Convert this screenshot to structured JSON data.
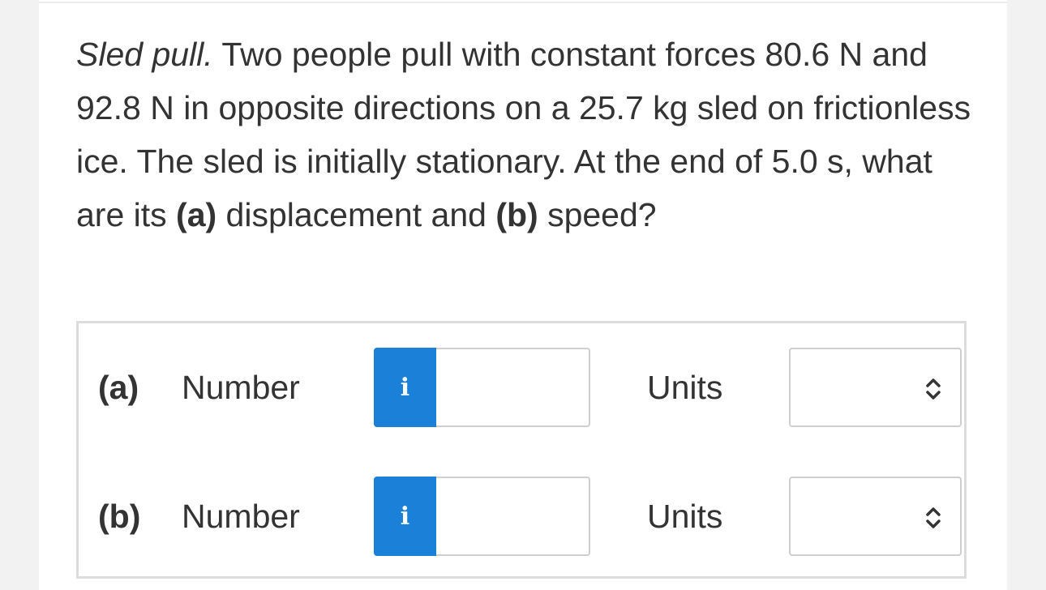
{
  "question": {
    "title": "Sled pull.",
    "text_1": " Two people pull with constant forces 80.6 N and 92.8 N in opposite directions on a 25.7 kg sled on frictionless ice. The sled is initially stationary. At the end of 5.0 s, what are its ",
    "part_a_marker": "(a)",
    "text_2": " displacement and ",
    "part_b_marker": "(b)",
    "text_3": " speed?"
  },
  "answers": [
    {
      "part_label": "(a)",
      "number_label": "Number",
      "info_glyph": "i",
      "number_value": "",
      "units_label": "Units",
      "units_selected": ""
    },
    {
      "part_label": "(b)",
      "number_label": "Number",
      "info_glyph": "i",
      "number_value": "",
      "units_label": "Units",
      "units_selected": ""
    }
  ],
  "colors": {
    "info_button": "#1a80d8",
    "text": "#333333",
    "border": "#dcdcdc"
  },
  "icons": {
    "info": "info-icon",
    "select_arrows": "chevron-up-down-icon"
  }
}
